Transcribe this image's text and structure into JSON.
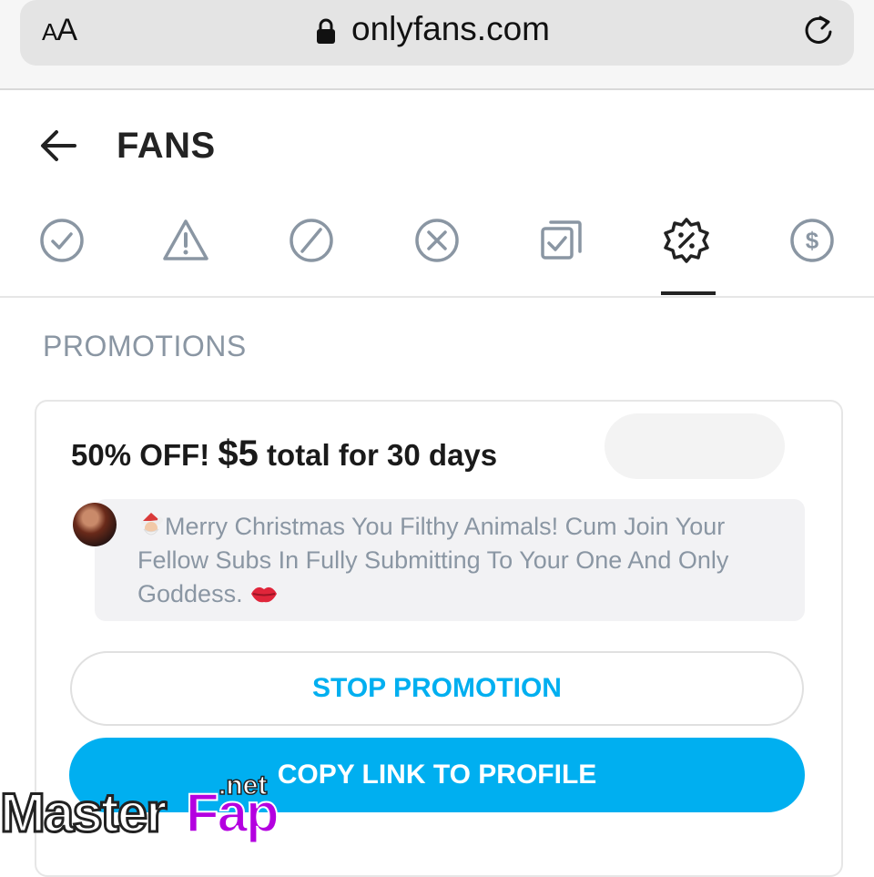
{
  "browser": {
    "text_size_label_small": "A",
    "text_size_label_large": "A",
    "url": "onlyfans.com"
  },
  "header": {
    "title": "FANS"
  },
  "tabs": [
    {
      "icon": "check-circle-icon"
    },
    {
      "icon": "warning-triangle-icon"
    },
    {
      "icon": "blocked-circle-icon"
    },
    {
      "icon": "x-circle-icon"
    },
    {
      "icon": "copy-check-icon"
    },
    {
      "icon": "promotion-badge-icon",
      "active": true
    },
    {
      "icon": "dollar-circle-icon"
    }
  ],
  "section": {
    "title": "PROMOTIONS"
  },
  "promotion": {
    "title_prefix": "50% OFF!",
    "price": "$5",
    "title_suffix": "total for 30 days",
    "message": "Merry Christmas You Filthy Animals! Cum Join Your Fellow Subs In Fully Submitting To Your One And Only Goddess.",
    "message_leading_emoji": "santa-emoji",
    "message_trailing_emoji": "kiss-lips-emoji"
  },
  "buttons": {
    "stop_promotion": "STOP PROMOTION",
    "copy_link": "COPY LINK TO PROFILE"
  },
  "watermark": {
    "part1": "Master",
    "part2": "Fap",
    "suffix": ".net"
  },
  "colors": {
    "accent": "#00aff0",
    "muted_text": "#8a96a3",
    "icon_gray": "#8a96a3",
    "active_icon": "#222222"
  }
}
